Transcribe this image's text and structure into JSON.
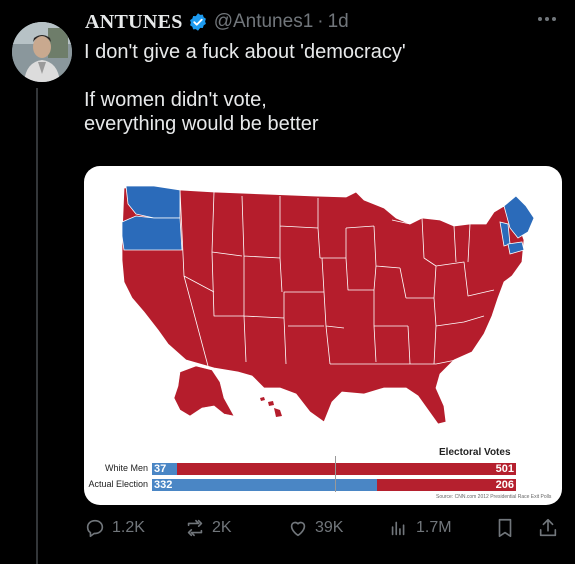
{
  "author": {
    "name": "ANTUNES",
    "handle": "@Antunes1",
    "separator": "·",
    "time": "1d"
  },
  "tweet": {
    "line1": "I don't give a fuck about 'democracy'",
    "line2": "If women didn't vote,",
    "line3": "everything would be better"
  },
  "chart_data": {
    "type": "bar",
    "title": "Electoral Votes",
    "categories": [
      "White Men",
      "Actual Election"
    ],
    "series": [
      {
        "name": "Blue",
        "values": [
          37,
          332
        ],
        "color": "#4a86c5"
      },
      {
        "name": "Red",
        "values": [
          501,
          206
        ],
        "color": "#b5202e"
      }
    ],
    "blue_labels": [
      "37",
      "332"
    ],
    "red_labels": [
      "501",
      "206"
    ],
    "source": "Source: CNN.com 2012 Presidential Race Exit Polls"
  },
  "colors": {
    "red_state": "#b51d2c",
    "blue_state": "#2b6bba",
    "verified": "#1d9bf0"
  },
  "actions": {
    "replies": "1.2K",
    "reposts": "2K",
    "likes": "39K",
    "views": "1.7M"
  }
}
